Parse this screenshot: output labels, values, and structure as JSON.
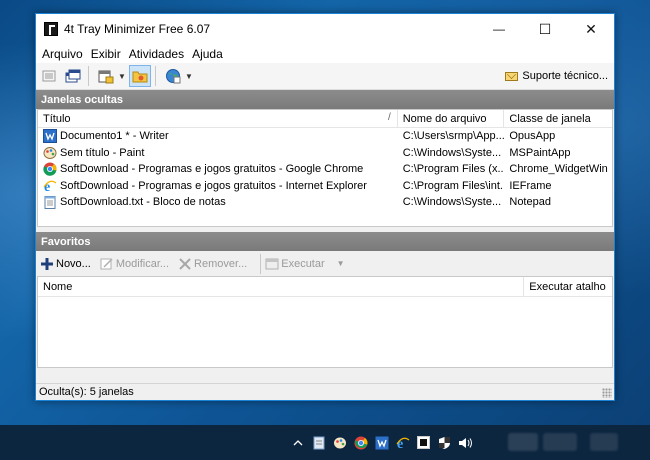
{
  "window": {
    "title": "4t Tray Minimizer Free 6.07",
    "controls": {
      "minimize": "—",
      "maximize": "☐",
      "close": "✕"
    }
  },
  "menubar": [
    "Arquivo",
    "Exibir",
    "Atividades",
    "Ajuda"
  ],
  "toolbar": {
    "support_label": "Suporte técnico..."
  },
  "hidden_windows": {
    "header": "Janelas ocultas",
    "columns": [
      "Título",
      "Nome do arquivo",
      "Classe de janela"
    ],
    "sort_indicator": "/",
    "rows": [
      {
        "icon": "writer-icon",
        "title": "Documento1 * - Writer",
        "file": "C:\\Users\\srmp\\App...",
        "class": "OpusApp"
      },
      {
        "icon": "paint-icon",
        "title": "Sem título - Paint",
        "file": "C:\\Windows\\Syste...",
        "class": "MSPaintApp"
      },
      {
        "icon": "chrome-icon",
        "title": "SoftDownload - Programas e jogos gratuitos - Google Chrome",
        "file": "C:\\Program Files (x...",
        "class": "Chrome_WidgetWin"
      },
      {
        "icon": "ie-icon",
        "title": "SoftDownload - Programas e jogos gratuitos - Internet Explorer",
        "file": "C:\\Program Files\\int...",
        "class": "IEFrame"
      },
      {
        "icon": "notepad-icon",
        "title": "SoftDownload.txt - Bloco de notas",
        "file": "C:\\Windows\\Syste...",
        "class": "Notepad"
      }
    ]
  },
  "favorites": {
    "header": "Favoritos",
    "buttons": {
      "new": "Novo...",
      "modify": "Modificar...",
      "remove": "Remover...",
      "execute": "Executar"
    },
    "columns": [
      "Nome",
      "Executar atalho"
    ]
  },
  "status": {
    "text": "Oculta(s): 5 janelas"
  },
  "colors": {
    "accent": "#1883d7",
    "section_header": "#808080",
    "desktop": "#0e5596",
    "taskbar": "#0d2640"
  }
}
